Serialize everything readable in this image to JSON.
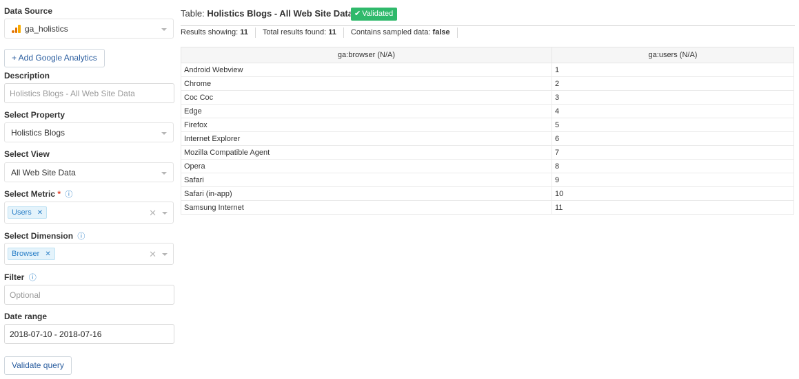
{
  "form": {
    "data_source": {
      "label": "Data Source",
      "value": "ga_holistics",
      "icon": "google-analytics-icon"
    },
    "add_ga_label": "+ Add Google Analytics",
    "description": {
      "label": "Description",
      "placeholder": "Holistics Blogs - All Web Site Data"
    },
    "property": {
      "label": "Select Property",
      "value": "Holistics Blogs"
    },
    "view": {
      "label": "Select View",
      "value": "All Web Site Data"
    },
    "metric": {
      "label": "Select Metric",
      "required_mark": "*",
      "info_icon": "ⓘ",
      "tags": [
        "Users"
      ]
    },
    "dimension": {
      "label": "Select Dimension",
      "info_icon": "ⓘ",
      "tags": [
        "Browser"
      ]
    },
    "filter": {
      "label": "Filter",
      "info_icon": "ⓘ",
      "placeholder": "Optional"
    },
    "date_range": {
      "label": "Date range",
      "value": "2018-07-10 - 2018-07-16"
    },
    "validate_label": "Validate query"
  },
  "results": {
    "title_prefix": "Table:",
    "title_name": "Holistics Blogs - All Web Site Data",
    "badge": "Validated",
    "badge_color": "#2fb96b",
    "stats": {
      "showing_label": "Results showing:",
      "showing_value": "11",
      "total_label": "Total results found:",
      "total_value": "11",
      "sampled_label": "Contains sampled data:",
      "sampled_value": "false"
    },
    "columns": [
      "ga:browser (N/A)",
      "ga:users (N/A)"
    ],
    "rows": [
      [
        "Android Webview",
        "1"
      ],
      [
        "Chrome",
        "2"
      ],
      [
        "Coc Coc",
        "3"
      ],
      [
        "Edge",
        "4"
      ],
      [
        "Firefox",
        "5"
      ],
      [
        "Internet Explorer",
        "6"
      ],
      [
        "Mozilla Compatible Agent",
        "7"
      ],
      [
        "Opera",
        "8"
      ],
      [
        "Safari",
        "9"
      ],
      [
        "Safari (in-app)",
        "10"
      ],
      [
        "Samsung Internet",
        "11"
      ]
    ]
  }
}
